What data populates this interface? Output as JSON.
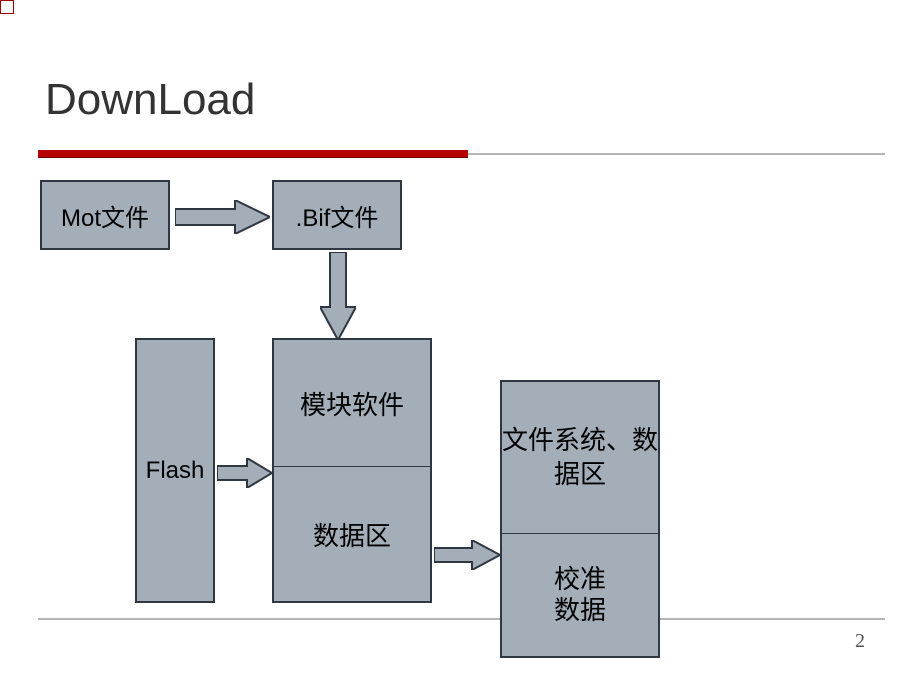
{
  "title": "DownLoad",
  "page_number": "2",
  "boxes": {
    "mot": "Mot文件",
    "bif": ".Bif文件",
    "flash": "Flash",
    "module_sw": "模块软件",
    "data_area": "数据区",
    "fs_data": "文件系统、数据区",
    "calib": "校准\n数据"
  },
  "colors": {
    "box_fill": "#a4aeb8",
    "box_border": "#2f3842",
    "arrow_fill": "#a4aeb8",
    "arrow_border": "#2f3842",
    "rule_red": "#b60000"
  },
  "chart_data": {
    "type": "diagram",
    "title": "DownLoad",
    "nodes": [
      {
        "id": "mot",
        "label": "Mot文件"
      },
      {
        "id": "bif",
        "label": ".Bif文件"
      },
      {
        "id": "flash",
        "label": "Flash"
      },
      {
        "id": "module_sw",
        "label": "模块软件"
      },
      {
        "id": "data_area",
        "label": "数据区"
      },
      {
        "id": "fs_data",
        "label": "文件系统、数据区"
      },
      {
        "id": "calib",
        "label": "校准数据"
      }
    ],
    "edges": [
      {
        "from": "mot",
        "to": "bif"
      },
      {
        "from": "bif",
        "to": "module_sw"
      },
      {
        "from": "flash",
        "to": "module_sw"
      },
      {
        "from": "data_area",
        "to": "calib"
      }
    ],
    "groups": [
      {
        "id": "middle_stack",
        "members": [
          "module_sw",
          "data_area"
        ],
        "note": "stacked, shared border"
      },
      {
        "id": "right_stack",
        "members": [
          "fs_data",
          "calib"
        ],
        "note": "stacked, shared border"
      }
    ]
  }
}
